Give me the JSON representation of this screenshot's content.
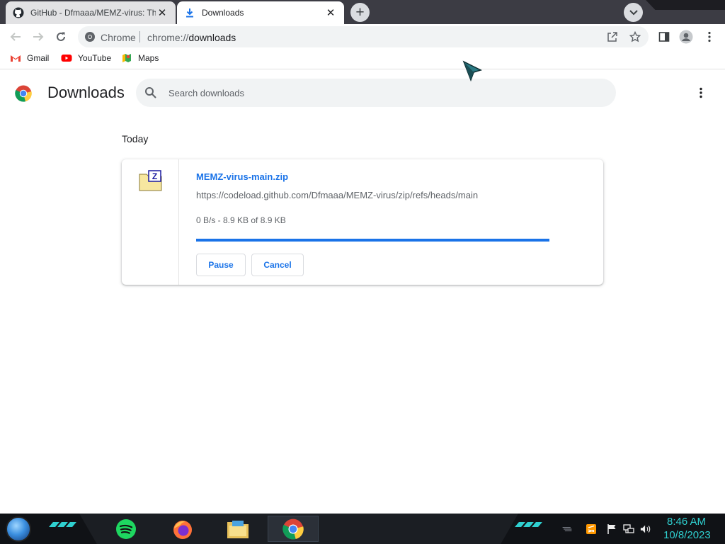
{
  "tabs": [
    {
      "title": "GitHub - Dfmaaa/MEMZ-virus: Th",
      "active": false
    },
    {
      "title": "Downloads",
      "active": true
    }
  ],
  "omnibox": {
    "site": "Chrome",
    "url_scheme": "chrome://",
    "url_path": "downloads"
  },
  "bookmarks": [
    {
      "label": "Gmail"
    },
    {
      "label": "YouTube"
    },
    {
      "label": "Maps"
    }
  ],
  "page": {
    "title": "Downloads",
    "search_placeholder": "Search downloads",
    "section_label": "Today"
  },
  "download": {
    "file_name": "MEMZ-virus-main.zip",
    "url": "https://codeload.github.com/Dfmaaa/MEMZ-virus/zip/refs/heads/main",
    "status": "0 B/s - 8.9 KB of 8.9 KB",
    "progress_fraction": 1.0,
    "pause_label": "Pause",
    "cancel_label": "Cancel"
  },
  "taskbar": {
    "apps": [
      "start-orb",
      "spotify",
      "firefox",
      "file-explorer",
      "chrome"
    ],
    "time": "8:46 AM",
    "date": "10/8/2023"
  },
  "colors": {
    "accent": "#1a73e8",
    "tabstrip": "#3c3c44",
    "clock": "#2fd0d0"
  }
}
